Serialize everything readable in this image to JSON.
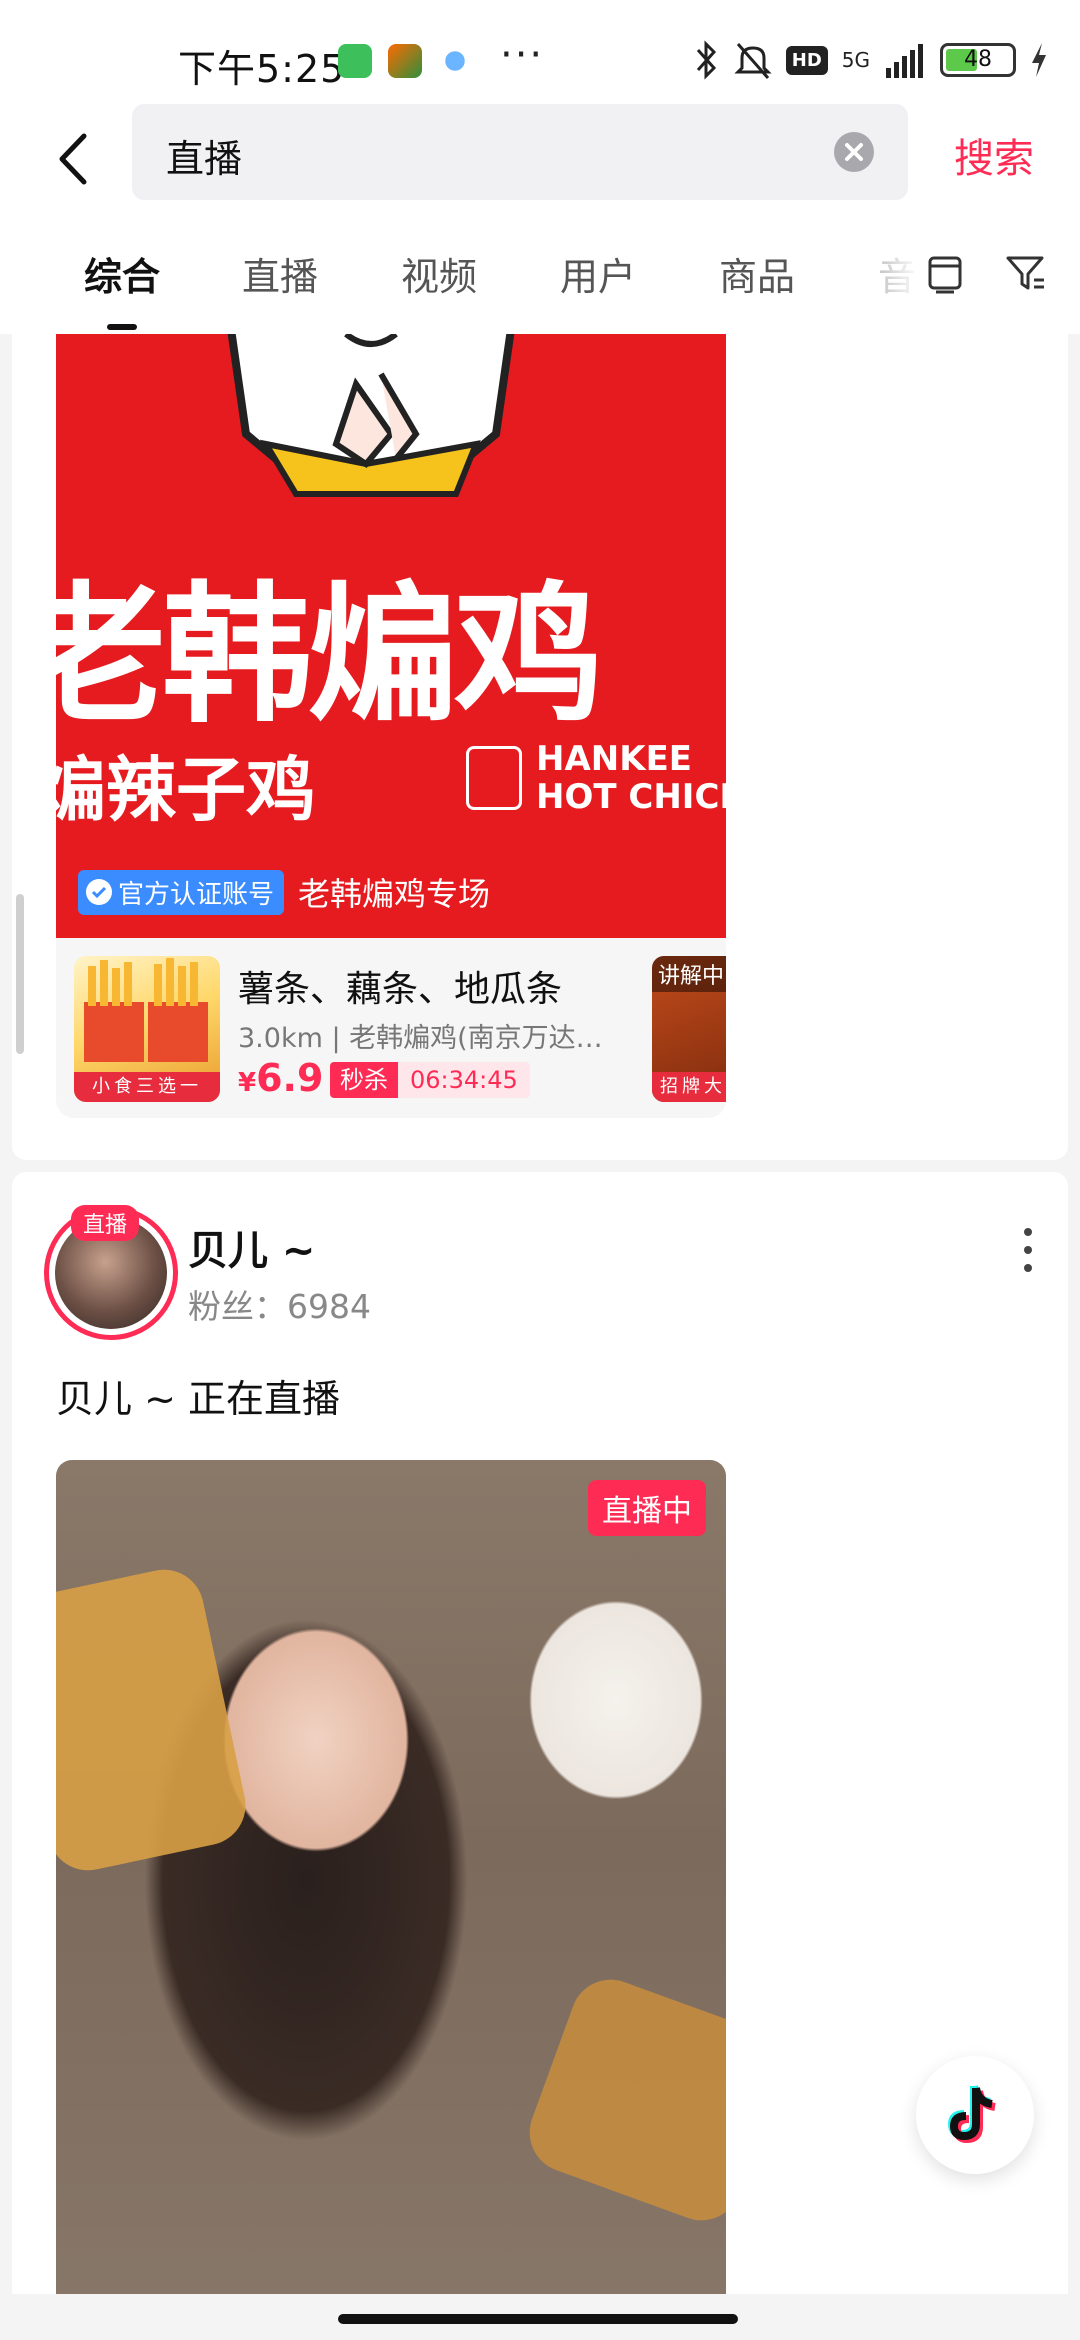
{
  "status_bar": {
    "time": "下午5:25",
    "network": "5G",
    "hd": "HD",
    "battery": "48",
    "battery_level": 0.48
  },
  "search": {
    "query": "直播",
    "submit_label": "搜索"
  },
  "tabs": [
    {
      "label": "综合",
      "active": true
    },
    {
      "label": "直播",
      "active": false
    },
    {
      "label": "视频",
      "active": false
    },
    {
      "label": "用户",
      "active": false
    },
    {
      "label": "商品",
      "active": false
    },
    {
      "label": "音",
      "active": false
    }
  ],
  "card_live_shop": {
    "brand_title": "老韩煸鸡",
    "brand_subtitle": "煸辣子鸡",
    "brand_en_line1": "HANKEE",
    "brand_en_line2": "HOT CHICK",
    "verified_label": "官方认证账号",
    "live_name": "老韩煸鸡专场",
    "product": {
      "title": "薯条、藕条、地瓜条",
      "meta": "3.0km | 老韩煸鸡(南京万达…",
      "price_symbol": "¥",
      "price": "6.9",
      "flash_label": "秒杀",
      "countdown": "06:34:45",
      "image_tag": "小食三选一"
    },
    "product2": {
      "tag_top": "讲解中",
      "tag_bottom": "招牌大"
    }
  },
  "card_user": {
    "avatar_live_label": "直播",
    "name": "贝儿 ~",
    "fans_label": "粉丝：",
    "fans_count": "6984",
    "description": "贝儿 ~ 正在直播",
    "live_tag": "直播中"
  },
  "colors": {
    "accent": "#fe2c55",
    "brand_red": "#e51b1f",
    "verified_blue": "#3b8cff"
  },
  "icons": [
    "back-arrow-icon",
    "clear-icon",
    "layout-icon",
    "filter-icon",
    "more-icon",
    "douyin-logo-icon",
    "bluetooth-icon",
    "mute-icon",
    "signal-icon",
    "charging-icon"
  ]
}
